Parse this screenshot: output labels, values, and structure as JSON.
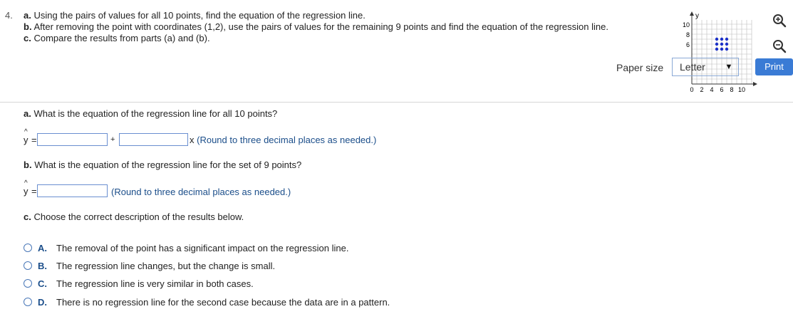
{
  "question_number": "4.",
  "prompt": {
    "a_label": "a.",
    "a_text": "Using the pairs of values for all 10 points, find the equation of the regression line.",
    "b_label": "b.",
    "b_text": "After removing the point with coordinates (1,2), use the pairs of values for the remaining 9 points and find the equation of the regression line.",
    "c_label": "c.",
    "c_text": "Compare the results from parts (a) and (b)."
  },
  "thumbnail": {
    "y_axis_label": "y",
    "y_ticks": [
      "10",
      "8",
      "6"
    ],
    "x_ticks": [
      "0",
      "2",
      "4",
      "6",
      "8",
      "10"
    ]
  },
  "toolbar": {
    "paper_size_label": "Paper size",
    "paper_size_value": "Letter",
    "print_label": "Print"
  },
  "part_a": {
    "label": "a.",
    "question": "What is the equation of the regression line for all 10 points?",
    "yhat": "y",
    "hat": "^",
    "equals": "=",
    "plus": "+",
    "x_suffix": "x",
    "hint": "(Round to three decimal places as needed.)",
    "intercept_value": "",
    "slope_value": ""
  },
  "part_b": {
    "label": "b.",
    "question": "What is the equation of the regression line for the set of 9 points?",
    "yhat": "y",
    "hat": "^",
    "equals": "=",
    "hint": "(Round to three decimal places as needed.)",
    "answer_value": ""
  },
  "part_c": {
    "label": "c.",
    "question": "Choose the correct description of the results below.",
    "options": [
      {
        "letter": "A.",
        "text": "The removal of the point has a significant impact on the regression line."
      },
      {
        "letter": "B.",
        "text": "The regression line changes, but the change is small."
      },
      {
        "letter": "C.",
        "text": "The regression line is very similar in both cases."
      },
      {
        "letter": "D.",
        "text": "There is no regression line for the second case because the data are in a pattern."
      }
    ]
  },
  "colors": {
    "accent": "#3a7bd5",
    "link": "#1b4e8a",
    "input_border": "#6a8fd0",
    "dots": "#1a2fc8"
  }
}
